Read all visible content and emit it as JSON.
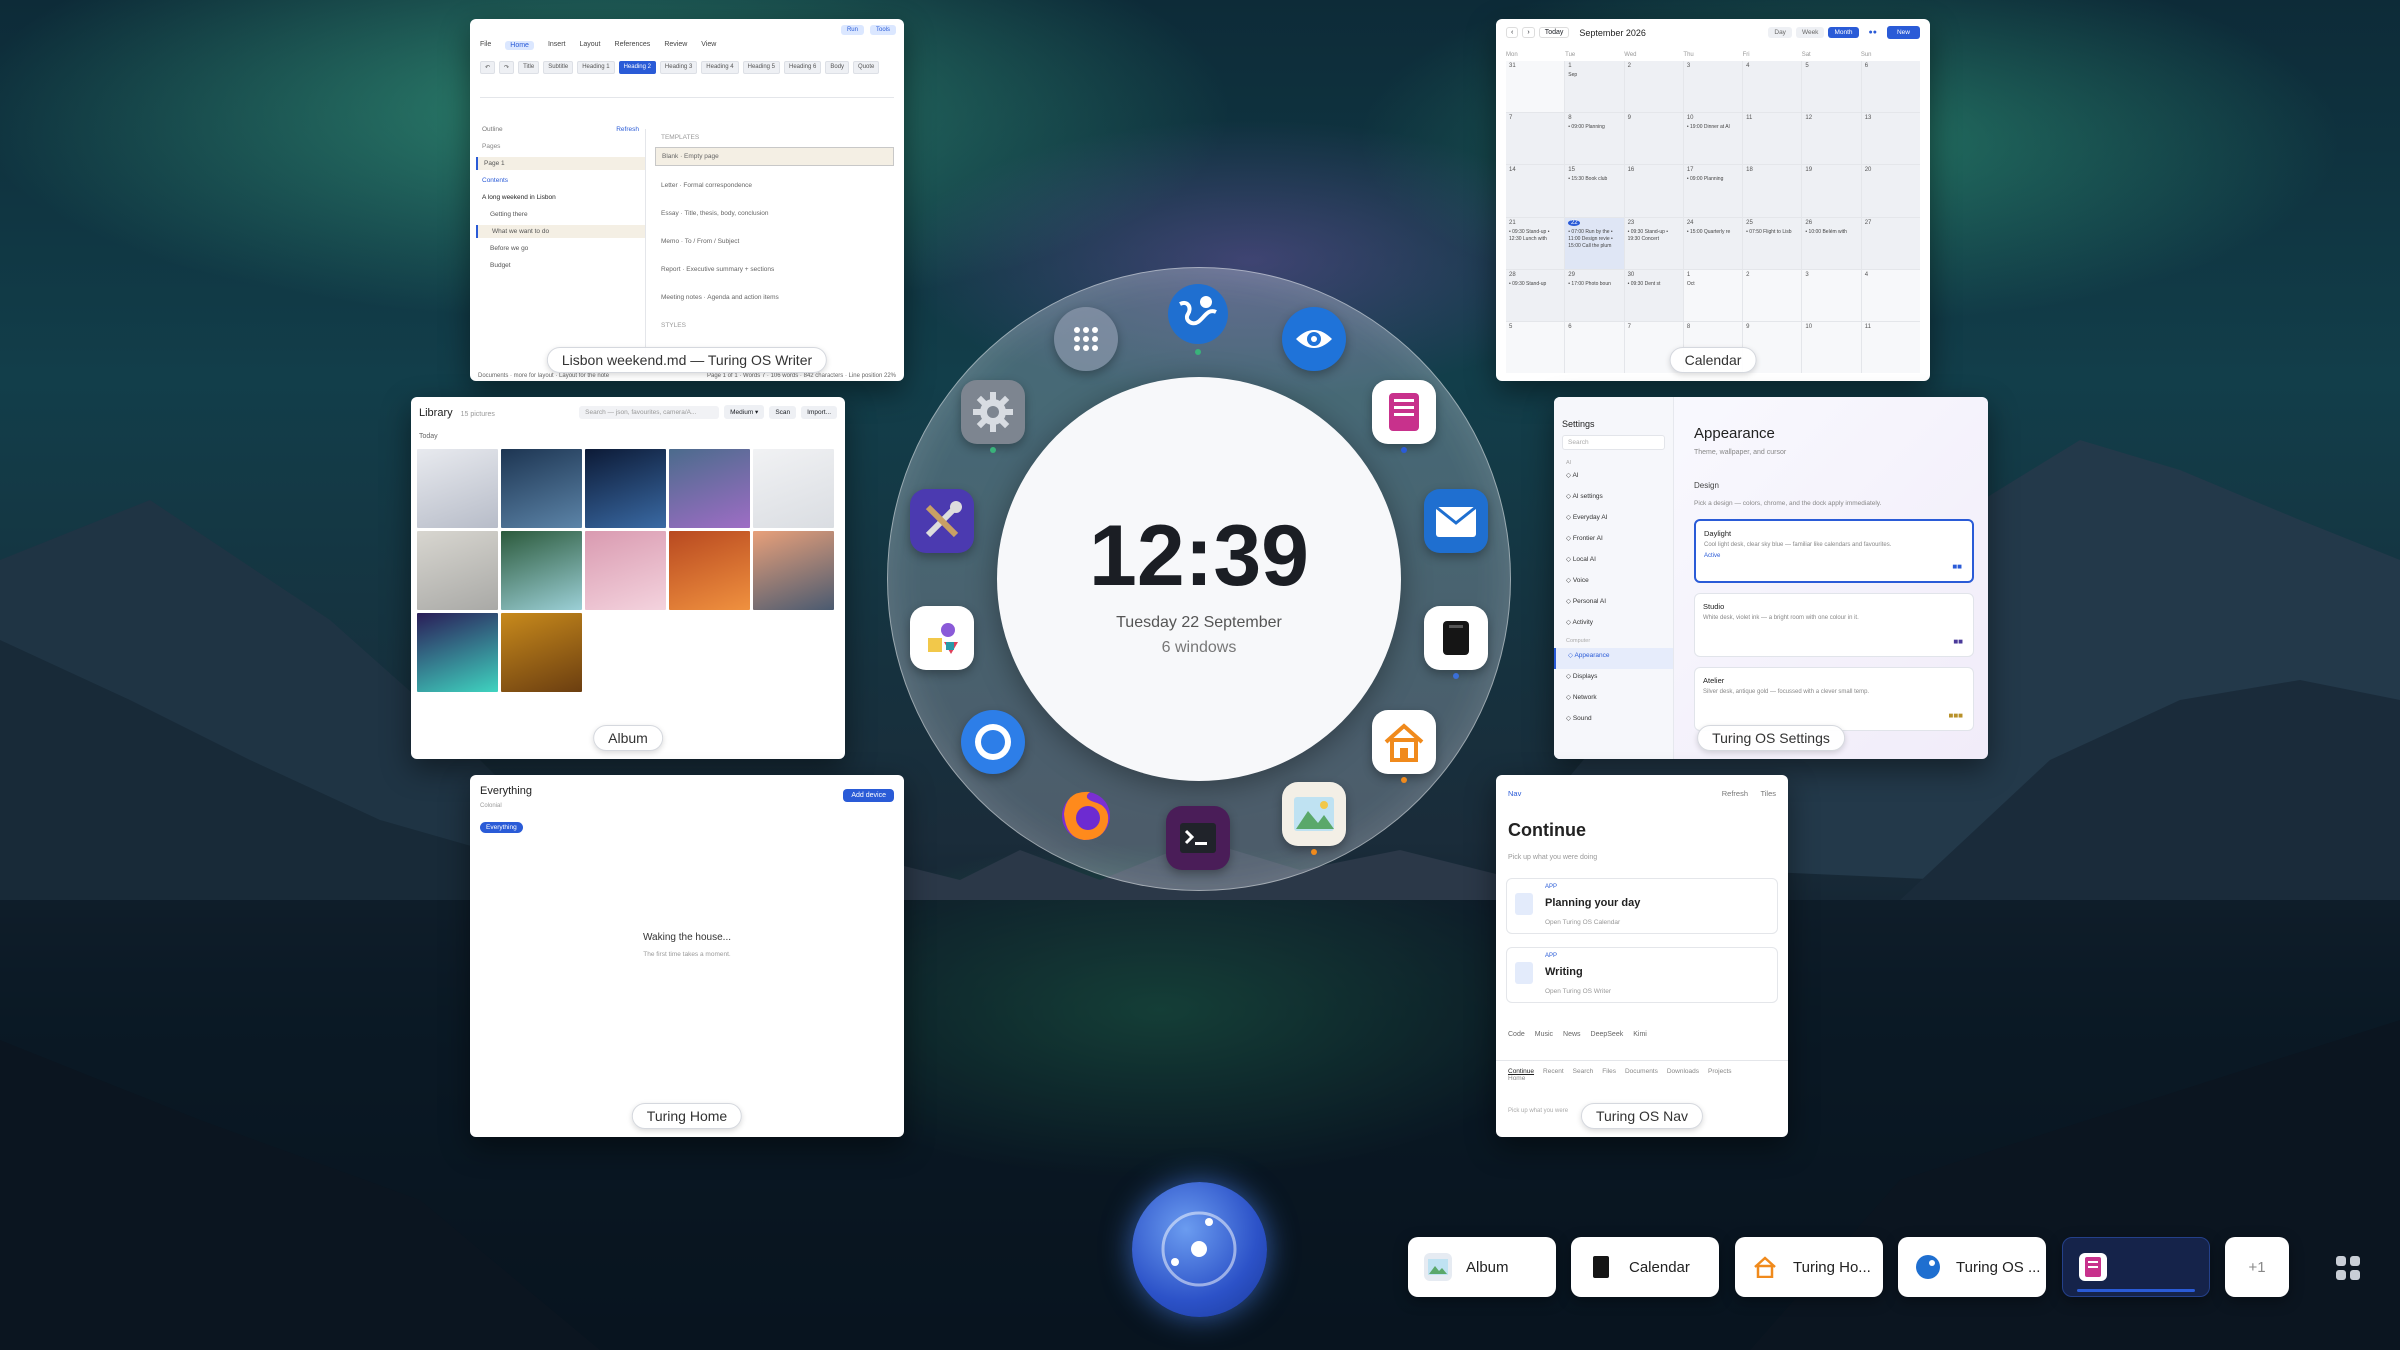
{
  "writer": {
    "label": "Lisbon weekend.md — Turing OS Writer",
    "menu": [
      "File",
      "Home",
      "Insert",
      "Layout",
      "References",
      "Review",
      "View"
    ],
    "active_menu": "Home",
    "buttons": [
      "Run",
      "Tools"
    ],
    "styles": [
      "Title",
      "Subtitle",
      "Heading 1",
      "Heading 2",
      "Heading 3",
      "Heading 4",
      "Heading 5",
      "Heading 6",
      "Body",
      "Quote"
    ],
    "active_style": "Heading 2",
    "outline_title": "Outline",
    "outline_action": "Refresh",
    "pages_label": "Pages",
    "page_item": "Page 1",
    "contents_label": "Contents",
    "doc_title": "A long weekend in Lisbon",
    "outline": [
      "Getting there",
      "What we want to do",
      "Before we go",
      "Budget"
    ],
    "selected_outline": "What we want to do",
    "templates_label": "TEMPLATES",
    "templates": [
      "Blank · Empty page",
      "Letter · Formal correspondence",
      "Essay · Title, thesis, body, conclusion",
      "Memo · To / From / Subject",
      "Report · Executive summary + sections",
      "Meeting notes · Agenda and action items"
    ],
    "styles_label": "STYLES",
    "status_left": "Documents · more for layout · Layout for the note",
    "status_right": "Page 1 of 1 · Words 7 · 106 words · 842 characters · Line position 22%"
  },
  "calendar": {
    "label": "Calendar",
    "today_btn": "Today",
    "month": "September 2026",
    "views": [
      "Day",
      "Week",
      "Month"
    ],
    "active_view": "Month",
    "new_btn": "New",
    "weekdays": [
      "Mon",
      "Tue",
      "Wed",
      "Thu",
      "Fri",
      "Sat",
      "Sun"
    ],
    "cells": [
      {
        "d": "31",
        "o": true
      },
      {
        "d": "1",
        "e": "Sep"
      },
      {
        "d": "2"
      },
      {
        "d": "3"
      },
      {
        "d": "4"
      },
      {
        "d": "5"
      },
      {
        "d": "6"
      },
      {
        "d": "7"
      },
      {
        "d": "8",
        "e": "• 09:00 Planning"
      },
      {
        "d": "9"
      },
      {
        "d": "10",
        "e": "• 19:00 Dinner at Al"
      },
      {
        "d": "11"
      },
      {
        "d": "12"
      },
      {
        "d": "13"
      },
      {
        "d": "14"
      },
      {
        "d": "15",
        "e": "• 15:30 Book club"
      },
      {
        "d": "16"
      },
      {
        "d": "17",
        "e": "• 09:00 Planning"
      },
      {
        "d": "18"
      },
      {
        "d": "19"
      },
      {
        "d": "20"
      },
      {
        "d": "21",
        "e": "• 09:30 Stand-up • 12:30 Lunch with"
      },
      {
        "d": "22",
        "e": "• 07:00 Run by the • 11:00 Design revie • 15:00 Call the plum",
        "t": true
      },
      {
        "d": "23",
        "e": "• 09:30 Stand-up • 19:30 Concert"
      },
      {
        "d": "24",
        "e": "• 15:00 Quarterly re"
      },
      {
        "d": "25",
        "e": "• 07:50 Flight to Lisb"
      },
      {
        "d": "26",
        "e": "• 10:00 Belém with"
      },
      {
        "d": "27"
      },
      {
        "d": "28",
        "e": "• 09:30 Stand-up"
      },
      {
        "d": "29",
        "e": "• 17:00 Photo boun"
      },
      {
        "d": "30",
        "e": "• 09:30 Dent st"
      },
      {
        "d": "1",
        "o": true,
        "e": "Oct"
      },
      {
        "d": "2",
        "o": true
      },
      {
        "d": "3",
        "o": true
      },
      {
        "d": "4",
        "o": true
      },
      {
        "d": "5",
        "o": true
      },
      {
        "d": "6",
        "o": true
      },
      {
        "d": "7",
        "o": true
      },
      {
        "d": "8",
        "o": true
      },
      {
        "d": "9",
        "o": true
      },
      {
        "d": "10",
        "o": true
      },
      {
        "d": "11",
        "o": true
      }
    ]
  },
  "album": {
    "label": "Album",
    "title": "Library",
    "count": "15 pictures",
    "search_placeholder": "Search — json, favourites, camera/A...",
    "size": "Medium",
    "scan": "Scan",
    "import": "Import...",
    "section": "Today",
    "thumb_colors": [
      [
        "#e8eaef",
        "#b7bcc8"
      ],
      [
        "#1d3552",
        "#5c84a8"
      ],
      [
        "#0c1a36",
        "#3a6aa4"
      ],
      [
        "#4b6b8c",
        "#9e6dc5"
      ],
      [
        "#f1f2f4",
        "#dadde2"
      ],
      [
        "#d8d6d0",
        "#a9a9a6"
      ],
      [
        "#2c5a3c",
        "#9bcfd6"
      ],
      [
        "#d99ab0",
        "#f4d3de"
      ],
      [
        "#b84920",
        "#f0913f"
      ],
      [
        "#e8a07a",
        "#4a5a70"
      ],
      [
        "#2a1d58",
        "#3fd4c0"
      ],
      [
        "#c88a1c",
        "#6b3e10"
      ]
    ]
  },
  "settings": {
    "label": "Turing OS Settings",
    "title": "Settings",
    "search_placeholder": "Search",
    "section_ai": "AI",
    "items": [
      "AI",
      "AI settings",
      "Everyday AI",
      "Frontier AI",
      "Local AI",
      "Voice",
      "Personal AI",
      "Activity"
    ],
    "section_computer": "Computer",
    "items2": [
      "Appearance",
      "Displays",
      "Network",
      "Sound"
    ],
    "selected_item": "Appearance",
    "heading": "Appearance",
    "subheading": "Theme, wallpaper, and cursor",
    "design_label": "Design",
    "design_desc": "Pick a design — colors, chrome, and the dock apply immediately.",
    "themes": [
      {
        "name": "Daylight",
        "desc": "Cool light desk, clear sky blue — familiar like calendars and favourites.",
        "status": "Active"
      },
      {
        "name": "Studio",
        "desc": "White desk, violet ink — a bright room with one colour in it.",
        "status": ""
      },
      {
        "name": "Atelier",
        "desc": "Silver desk, antique gold — focussed with a clever small temp.",
        "status": ""
      }
    ]
  },
  "home": {
    "label": "Turing Home",
    "title": "Everything",
    "subtitle": "Colonial",
    "add_btn": "Add device",
    "chip": "Everything",
    "loading": "Waking the house...",
    "loading_sub": "The first time takes a moment."
  },
  "nav": {
    "label": "Turing OS Nav",
    "brand": "Nav",
    "refresh": "Refresh",
    "tiles": "Tiles",
    "heading": "Continue",
    "subheading": "Pick up what you were doing",
    "rows": [
      {
        "tag": "APP",
        "title": "Planning your day",
        "sub": "Open Turing OS Calendar"
      },
      {
        "tag": "APP",
        "title": "Writing",
        "sub": "Open Turing OS Writer"
      }
    ],
    "links": [
      "Code",
      "Music",
      "News",
      "DeepSeek",
      "Kimi"
    ],
    "tabs": [
      "Continue",
      "Recent",
      "Search",
      "Files",
      "Documents",
      "Downloads",
      "Projects",
      "Home"
    ],
    "footer": "Pick up what you were"
  },
  "dial": {
    "time": "12:39",
    "date": "Tuesday 22 September",
    "windows": "6 windows",
    "apps": [
      "app-grid",
      "browser",
      "eye",
      "writer",
      "mail",
      "notes",
      "home",
      "photos",
      "terminal",
      "firefox",
      "chromium",
      "shapes",
      "tools",
      "settings"
    ]
  },
  "dock": {
    "items": [
      {
        "label": "Album",
        "icon": "album-icon"
      },
      {
        "label": "Calendar",
        "icon": "calendar-icon"
      },
      {
        "label": "Turing Ho...",
        "icon": "home-icon"
      },
      {
        "label": "Turing OS ...",
        "icon": "globe-icon"
      }
    ],
    "more": "+1"
  },
  "colors": {
    "accent": "#2a5bd7",
    "writer_pink": "#c8318c"
  }
}
